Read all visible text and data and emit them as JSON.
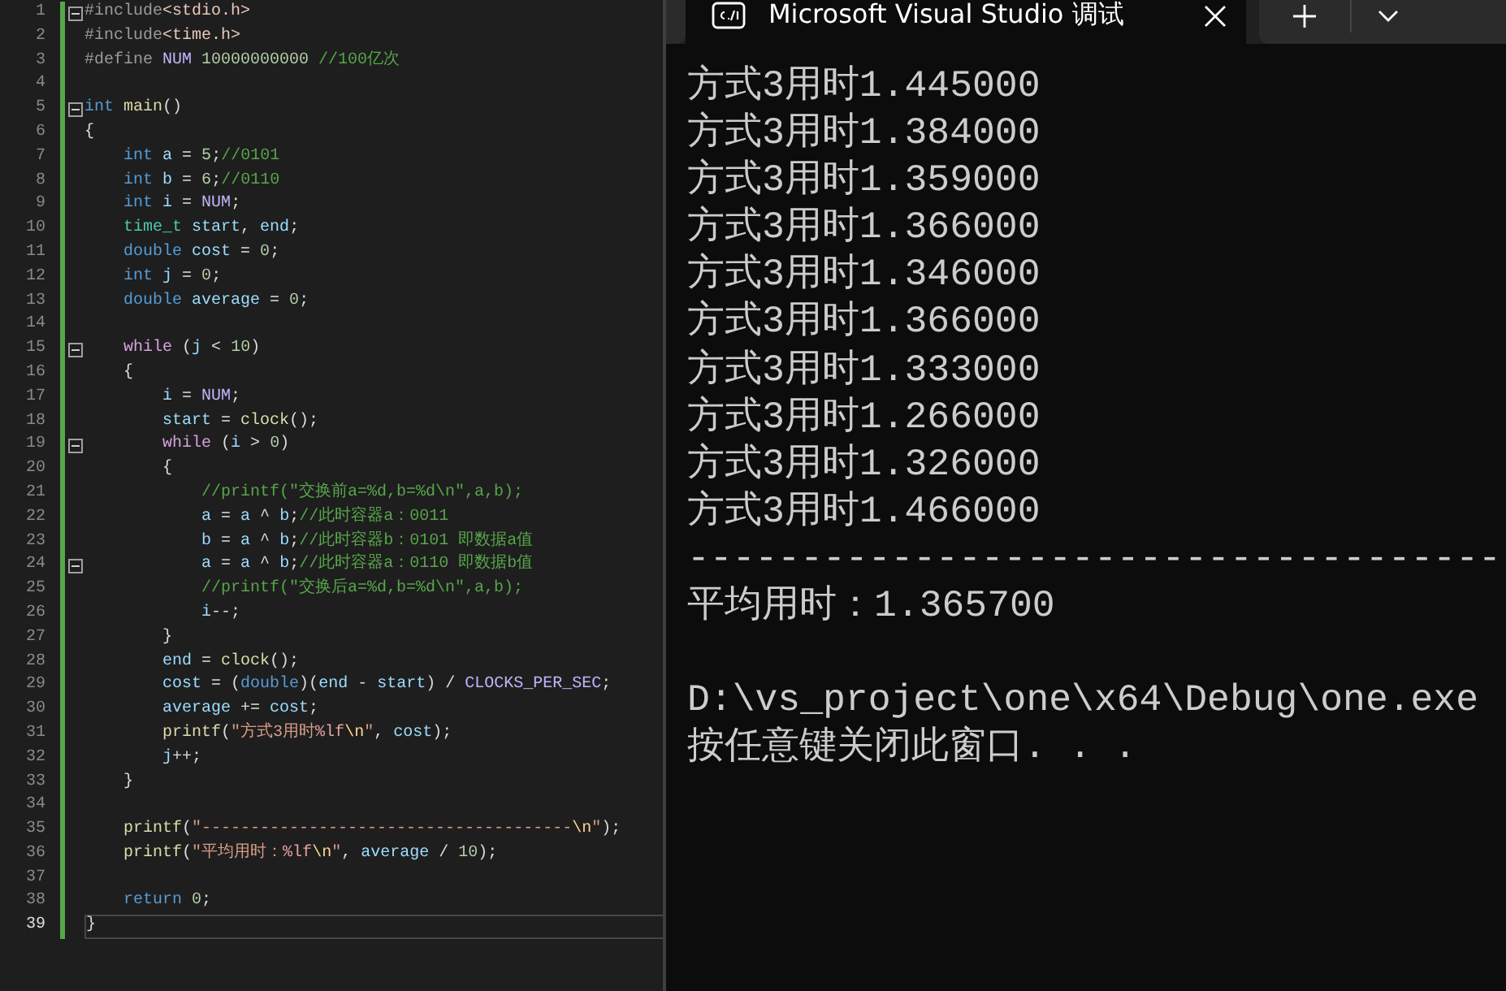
{
  "editor": {
    "lines": [
      {
        "number": "1",
        "fold": true,
        "current": false,
        "tokens": [
          {
            "kind": "preproc",
            "text": "#include"
          },
          {
            "kind": "header",
            "text": "<stdio.h>"
          }
        ]
      },
      {
        "number": "2",
        "fold": false,
        "current": false,
        "tokens": [
          {
            "kind": "preproc",
            "text": "#include"
          },
          {
            "kind": "header",
            "text": "<time.h>"
          }
        ]
      },
      {
        "number": "3",
        "fold": false,
        "current": false,
        "tokens": [
          {
            "kind": "preproc",
            "text": "#define "
          },
          {
            "kind": "macro",
            "text": "NUM"
          },
          {
            "kind": "number",
            "text": " 10000000000"
          },
          {
            "kind": "comment",
            "text": " //100亿次"
          }
        ]
      },
      {
        "number": "4",
        "fold": false,
        "current": false
      },
      {
        "number": "5",
        "fold": true,
        "current": false,
        "tokens": [
          {
            "kind": "keyword",
            "text": "int "
          },
          {
            "kind": "function",
            "text": "main"
          },
          {
            "kind": "plain",
            "text": "()"
          }
        ]
      },
      {
        "number": "6",
        "fold": false,
        "current": false,
        "tokens": [
          {
            "kind": "plain",
            "text": "{"
          }
        ]
      },
      {
        "number": "7",
        "fold": false,
        "current": false,
        "tokens": [
          {
            "kind": "keyword",
            "text": "    int "
          },
          {
            "kind": "variable",
            "text": "a"
          },
          {
            "kind": "plain",
            "text": " = "
          },
          {
            "kind": "number",
            "text": "5"
          },
          {
            "kind": "plain",
            "text": ";"
          },
          {
            "kind": "comment",
            "text": "//0101"
          }
        ]
      },
      {
        "number": "8",
        "fold": false,
        "current": false,
        "tokens": [
          {
            "kind": "keyword",
            "text": "    int "
          },
          {
            "kind": "variable",
            "text": "b"
          },
          {
            "kind": "plain",
            "text": " = "
          },
          {
            "kind": "number",
            "text": "6"
          },
          {
            "kind": "plain",
            "text": ";"
          },
          {
            "kind": "comment",
            "text": "//0110"
          }
        ]
      },
      {
        "number": "9",
        "fold": false,
        "current": false,
        "tokens": [
          {
            "kind": "keyword",
            "text": "    int "
          },
          {
            "kind": "variable",
            "text": "i"
          },
          {
            "kind": "plain",
            "text": " = "
          },
          {
            "kind": "macro",
            "text": "NUM"
          },
          {
            "kind": "plain",
            "text": ";"
          }
        ]
      },
      {
        "number": "10",
        "fold": false,
        "current": false,
        "tokens": [
          {
            "kind": "type",
            "text": "    time_t "
          },
          {
            "kind": "variable",
            "text": "start"
          },
          {
            "kind": "plain",
            "text": ", "
          },
          {
            "kind": "variable",
            "text": "end"
          },
          {
            "kind": "plain",
            "text": ";"
          }
        ]
      },
      {
        "number": "11",
        "fold": false,
        "current": false,
        "tokens": [
          {
            "kind": "keyword",
            "text": "    double "
          },
          {
            "kind": "variable",
            "text": "cost"
          },
          {
            "kind": "plain",
            "text": " = "
          },
          {
            "kind": "number",
            "text": "0"
          },
          {
            "kind": "plain",
            "text": ";"
          }
        ]
      },
      {
        "number": "12",
        "fold": false,
        "current": false,
        "tokens": [
          {
            "kind": "keyword",
            "text": "    int "
          },
          {
            "kind": "variable",
            "text": "j"
          },
          {
            "kind": "plain",
            "text": " = "
          },
          {
            "kind": "number",
            "text": "0"
          },
          {
            "kind": "plain",
            "text": ";"
          }
        ]
      },
      {
        "number": "13",
        "fold": false,
        "current": false,
        "tokens": [
          {
            "kind": "keyword",
            "text": "    double "
          },
          {
            "kind": "variable",
            "text": "average"
          },
          {
            "kind": "plain",
            "text": " = "
          },
          {
            "kind": "number",
            "text": "0"
          },
          {
            "kind": "plain",
            "text": ";"
          }
        ]
      },
      {
        "number": "14",
        "fold": false,
        "current": false
      },
      {
        "number": "15",
        "fold": true,
        "current": false,
        "tokens": [
          {
            "kind": "control",
            "text": "    while"
          },
          {
            "kind": "plain",
            "text": " ("
          },
          {
            "kind": "variable",
            "text": "j"
          },
          {
            "kind": "plain",
            "text": " < "
          },
          {
            "kind": "number",
            "text": "10"
          },
          {
            "kind": "plain",
            "text": ")"
          }
        ]
      },
      {
        "number": "16",
        "fold": false,
        "current": false,
        "tokens": [
          {
            "kind": "plain",
            "text": "    {"
          }
        ]
      },
      {
        "number": "17",
        "fold": false,
        "current": false,
        "tokens": [
          {
            "kind": "variable",
            "text": "        i"
          },
          {
            "kind": "plain",
            "text": " = "
          },
          {
            "kind": "macro",
            "text": "NUM"
          },
          {
            "kind": "plain",
            "text": ";"
          }
        ]
      },
      {
        "number": "18",
        "fold": false,
        "current": false,
        "tokens": [
          {
            "kind": "variable",
            "text": "        start"
          },
          {
            "kind": "plain",
            "text": " = "
          },
          {
            "kind": "function",
            "text": "clock"
          },
          {
            "kind": "plain",
            "text": "();"
          }
        ]
      },
      {
        "number": "19",
        "fold": true,
        "current": false,
        "tokens": [
          {
            "kind": "control",
            "text": "        while"
          },
          {
            "kind": "plain",
            "text": " ("
          },
          {
            "kind": "variable",
            "text": "i"
          },
          {
            "kind": "plain",
            "text": " > "
          },
          {
            "kind": "number",
            "text": "0"
          },
          {
            "kind": "plain",
            "text": ")"
          }
        ]
      },
      {
        "number": "20",
        "fold": false,
        "current": false,
        "tokens": [
          {
            "kind": "plain",
            "text": "        {"
          }
        ]
      },
      {
        "number": "21",
        "fold": false,
        "current": false,
        "tokens": [
          {
            "kind": "comment",
            "text": "            //printf(\"交换前a=%d,b=%d\\n\",a,b);"
          }
        ]
      },
      {
        "number": "22",
        "fold": false,
        "current": false,
        "tokens": [
          {
            "kind": "variable",
            "text": "            a"
          },
          {
            "kind": "plain",
            "text": " = "
          },
          {
            "kind": "variable",
            "text": "a"
          },
          {
            "kind": "plain",
            "text": " ^ "
          },
          {
            "kind": "variable",
            "text": "b"
          },
          {
            "kind": "plain",
            "text": ";"
          },
          {
            "kind": "comment",
            "text": "//此时容器a：0011"
          }
        ]
      },
      {
        "number": "23",
        "fold": false,
        "current": false,
        "tokens": [
          {
            "kind": "variable",
            "text": "            b"
          },
          {
            "kind": "plain",
            "text": " = "
          },
          {
            "kind": "variable",
            "text": "a"
          },
          {
            "kind": "plain",
            "text": " ^ "
          },
          {
            "kind": "variable",
            "text": "b"
          },
          {
            "kind": "plain",
            "text": ";"
          },
          {
            "kind": "comment",
            "text": "//此时容器b：0101 即数据a值"
          }
        ]
      },
      {
        "number": "24",
        "fold": true,
        "current": false,
        "tokens": [
          {
            "kind": "variable",
            "text": "            a"
          },
          {
            "kind": "plain",
            "text": " = "
          },
          {
            "kind": "variable",
            "text": "a"
          },
          {
            "kind": "plain",
            "text": " ^ "
          },
          {
            "kind": "variable",
            "text": "b"
          },
          {
            "kind": "plain",
            "text": ";"
          },
          {
            "kind": "comment",
            "text": "//此时容器a：0110 即数据b值"
          }
        ]
      },
      {
        "number": "25",
        "fold": false,
        "current": false,
        "tokens": [
          {
            "kind": "comment",
            "text": "            //printf(\"交换后a=%d,b=%d\\n\",a,b);"
          }
        ]
      },
      {
        "number": "26",
        "fold": false,
        "current": false,
        "tokens": [
          {
            "kind": "variable",
            "text": "            i"
          },
          {
            "kind": "plain",
            "text": "--;"
          }
        ]
      },
      {
        "number": "27",
        "fold": false,
        "current": false,
        "tokens": [
          {
            "kind": "plain",
            "text": "        }"
          }
        ]
      },
      {
        "number": "28",
        "fold": false,
        "current": false,
        "tokens": [
          {
            "kind": "variable",
            "text": "        end"
          },
          {
            "kind": "plain",
            "text": " = "
          },
          {
            "kind": "function",
            "text": "clock"
          },
          {
            "kind": "plain",
            "text": "();"
          }
        ]
      },
      {
        "number": "29",
        "fold": false,
        "current": false,
        "tokens": [
          {
            "kind": "variable",
            "text": "        cost"
          },
          {
            "kind": "plain",
            "text": " = ("
          },
          {
            "kind": "keyword",
            "text": "double"
          },
          {
            "kind": "plain",
            "text": ")("
          },
          {
            "kind": "variable",
            "text": "end"
          },
          {
            "kind": "plain",
            "text": " - "
          },
          {
            "kind": "variable",
            "text": "start"
          },
          {
            "kind": "plain",
            "text": ") / "
          },
          {
            "kind": "macro",
            "text": "CLOCKS_PER_SEC"
          },
          {
            "kind": "plain",
            "text": ";"
          }
        ]
      },
      {
        "number": "30",
        "fold": false,
        "current": false,
        "tokens": [
          {
            "kind": "variable",
            "text": "        average"
          },
          {
            "kind": "plain",
            "text": " += "
          },
          {
            "kind": "variable",
            "text": "cost"
          },
          {
            "kind": "plain",
            "text": ";"
          }
        ]
      },
      {
        "number": "31",
        "fold": false,
        "current": false,
        "tokens": [
          {
            "kind": "function",
            "text": "        printf"
          },
          {
            "kind": "plain",
            "text": "("
          },
          {
            "kind": "string",
            "text": "\"方式3用时"
          },
          {
            "kind": "format",
            "text": "%lf"
          },
          {
            "kind": "escape",
            "text": "\\n"
          },
          {
            "kind": "string",
            "text": "\""
          },
          {
            "kind": "plain",
            "text": ", "
          },
          {
            "kind": "variable",
            "text": "cost"
          },
          {
            "kind": "plain",
            "text": ");"
          }
        ]
      },
      {
        "number": "32",
        "fold": false,
        "current": false,
        "tokens": [
          {
            "kind": "variable",
            "text": "        j"
          },
          {
            "kind": "plain",
            "text": "++;"
          }
        ]
      },
      {
        "number": "33",
        "fold": false,
        "current": false,
        "tokens": [
          {
            "kind": "plain",
            "text": "    }"
          }
        ]
      },
      {
        "number": "34",
        "fold": false,
        "current": false
      },
      {
        "number": "35",
        "fold": false,
        "current": false,
        "tokens": [
          {
            "kind": "function",
            "text": "    printf"
          },
          {
            "kind": "plain",
            "text": "("
          },
          {
            "kind": "string",
            "text": "\"--------------------------------------"
          },
          {
            "kind": "escape",
            "text": "\\n"
          },
          {
            "kind": "string",
            "text": "\""
          },
          {
            "kind": "plain",
            "text": ");"
          }
        ]
      },
      {
        "number": "36",
        "fold": false,
        "current": false,
        "tokens": [
          {
            "kind": "function",
            "text": "    printf"
          },
          {
            "kind": "plain",
            "text": "("
          },
          {
            "kind": "string",
            "text": "\"平均用时："
          },
          {
            "kind": "format",
            "text": "%lf"
          },
          {
            "kind": "escape",
            "text": "\\n"
          },
          {
            "kind": "string",
            "text": "\""
          },
          {
            "kind": "plain",
            "text": ", "
          },
          {
            "kind": "variable",
            "text": "average"
          },
          {
            "kind": "plain",
            "text": " / "
          },
          {
            "kind": "number",
            "text": "10"
          },
          {
            "kind": "plain",
            "text": ");"
          }
        ]
      },
      {
        "number": "37",
        "fold": false,
        "current": false
      },
      {
        "number": "38",
        "fold": false,
        "current": false,
        "tokens": [
          {
            "kind": "keyword",
            "text": "    return "
          },
          {
            "kind": "number",
            "text": "0"
          },
          {
            "kind": "plain",
            "text": ";"
          }
        ]
      },
      {
        "number": "39",
        "fold": false,
        "current": true,
        "tokens": [
          {
            "kind": "plain",
            "text": "}"
          }
        ]
      }
    ]
  },
  "terminal": {
    "tab": {
      "title": "Microsoft Visual Studio 调试",
      "selected": true
    },
    "output": [
      {
        "kind": "text",
        "text": "方式3用时1.445000"
      },
      {
        "kind": "text",
        "text": "方式3用时1.384000"
      },
      {
        "kind": "text",
        "text": "方式3用时1.359000"
      },
      {
        "kind": "text",
        "text": "方式3用时1.366000"
      },
      {
        "kind": "text",
        "text": "方式3用时1.346000"
      },
      {
        "kind": "text",
        "text": "方式3用时1.366000"
      },
      {
        "kind": "text",
        "text": "方式3用时1.333000"
      },
      {
        "kind": "text",
        "text": "方式3用时1.266000"
      },
      {
        "kind": "text",
        "text": "方式3用时1.326000"
      },
      {
        "kind": "text",
        "text": "方式3用时1.466000"
      },
      {
        "kind": "text",
        "text": "------------------------------------"
      },
      {
        "kind": "text",
        "text": "平均用时：1.365700"
      },
      {
        "kind": "blank"
      },
      {
        "kind": "text",
        "text": "D:\\vs_project\\one\\x64\\Debug\\one.exe"
      },
      {
        "kind": "text",
        "text": "按任意键关闭此窗口. . ."
      }
    ]
  }
}
